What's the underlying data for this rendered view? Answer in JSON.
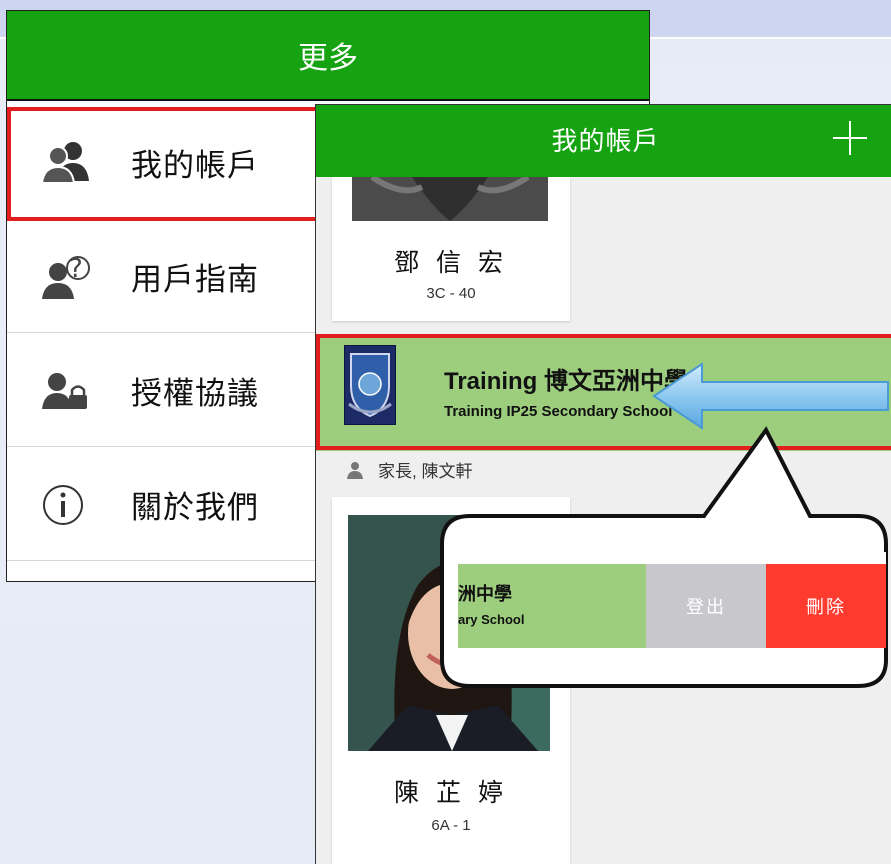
{
  "more": {
    "title": "更多",
    "items": [
      {
        "label": "我的帳戶",
        "icon": "users-icon"
      },
      {
        "label": "用戶指南",
        "icon": "user-help-icon"
      },
      {
        "label": "授權協議",
        "icon": "user-lock-icon"
      },
      {
        "label": "關於我們",
        "icon": "info-icon"
      }
    ]
  },
  "account": {
    "title": "我的帳戶",
    "add_icon": "plus-icon",
    "students": [
      {
        "name": "鄧 信 宏",
        "class": "3C - 40"
      },
      {
        "name": "陳 芷 婷",
        "class": "6A - 1"
      }
    ],
    "school": {
      "name": "Training 博文亞洲中學",
      "subtitle": "Training IP25 Secondary School"
    },
    "parent_line": "家長, 陳文軒"
  },
  "callout": {
    "school_name_partial": "洲中學",
    "school_sub_partial": "ary School",
    "logout_label": "登出",
    "delete_label": "刪除"
  },
  "colors": {
    "header_green": "#16a311",
    "row_green": "#9dce7e",
    "highlight_red": "#e41e1e",
    "delete_red": "#ff3b30",
    "logout_gray": "#c8c7cc",
    "arrow_blue": "#8ec9f0"
  }
}
